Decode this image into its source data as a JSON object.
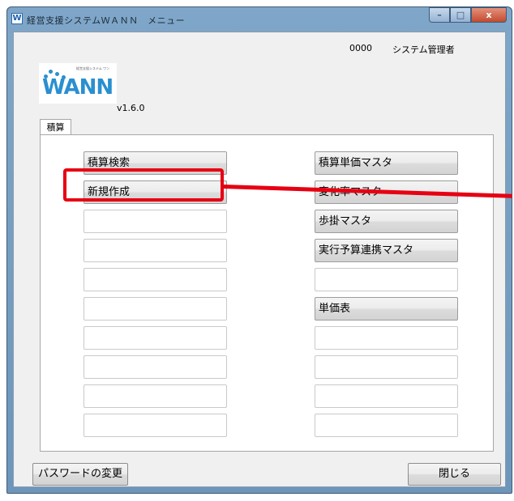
{
  "window": {
    "title": "経営支援システムＷＡＮＮ　メニュー",
    "app_icon_glyph": "W",
    "controls": {
      "minimize": "–",
      "maximize": "□",
      "close": "x"
    }
  },
  "header": {
    "user_code": "0000",
    "user_name": "システム管理者",
    "logo_text": "WANN",
    "logo_subtitle": "経営支援システム ワン",
    "version": "v1.6.0"
  },
  "tabs": [
    {
      "label": "積算",
      "selected": true
    }
  ],
  "left_buttons": [
    "積算検索",
    "新規作成",
    "",
    "",
    "",
    "",
    "",
    "",
    "",
    ""
  ],
  "right_buttons": [
    "積算単価マスタ",
    "変化率マスタ",
    "歩掛マスタ",
    "実行予算連携マスタ",
    "",
    "単価表",
    "",
    "",
    "",
    ""
  ],
  "footer": {
    "password_change": "パスワードの変更",
    "close": "閉じる"
  },
  "annotation": {
    "highlight_color": "#e60012",
    "highlighted_button": "新規作成"
  },
  "colors": {
    "title_bar": "#7fa6c8",
    "client_bg": "#f0f0f0",
    "accent": "#2a8fd0"
  }
}
